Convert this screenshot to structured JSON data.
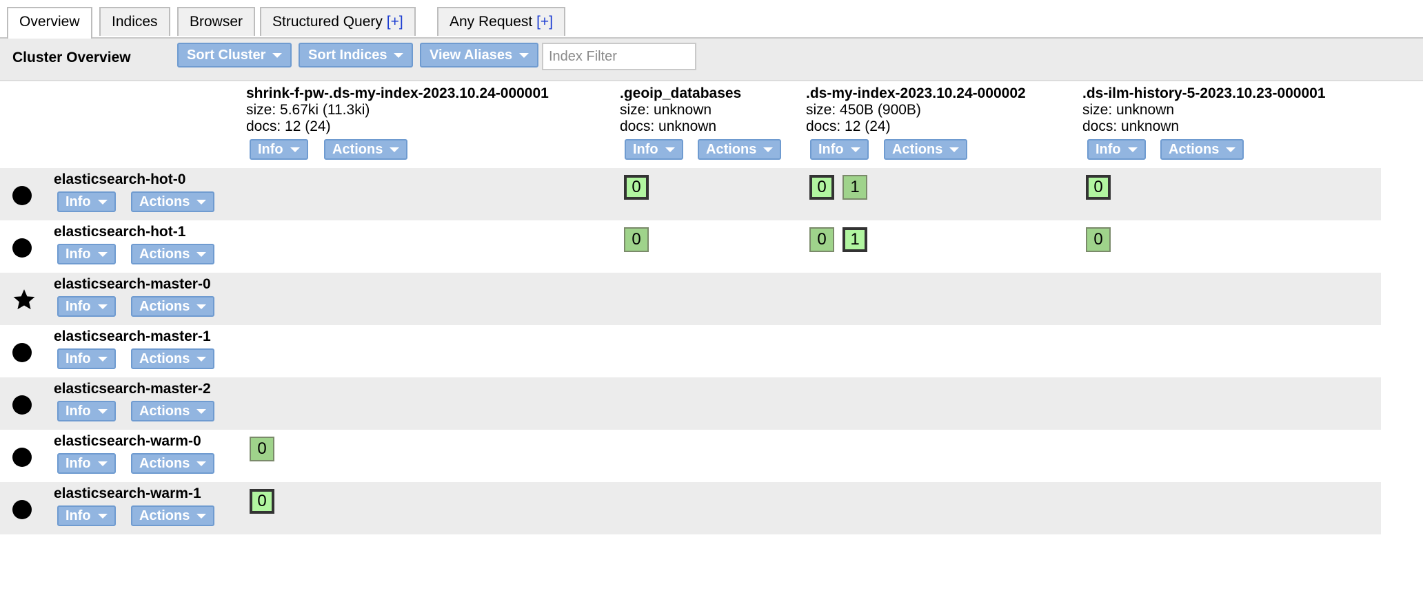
{
  "tabs": [
    {
      "label": "Overview",
      "plus": ""
    },
    {
      "label": "Indices",
      "plus": ""
    },
    {
      "label": "Browser",
      "plus": ""
    },
    {
      "label": "Structured Query",
      "plus": "[+]"
    },
    {
      "label": "Any Request",
      "plus": "[+]"
    }
  ],
  "toolbar": {
    "title": "Cluster Overview",
    "sort_cluster": "Sort Cluster",
    "sort_indices": "Sort Indices",
    "view_aliases": "View Aliases",
    "filter_placeholder": "Index Filter"
  },
  "buttons": {
    "info": "Info",
    "actions": "Actions"
  },
  "indices": [
    {
      "name": "shrink-f-pw-.ds-my-index-2023.10.24-000001",
      "size": "size: 5.67ki (11.3ki)",
      "docs": "docs: 12 (24)"
    },
    {
      "name": ".geoip_databases",
      "size": "size: unknown",
      "docs": "docs: unknown"
    },
    {
      "name": ".ds-my-index-2023.10.24-000002",
      "size": "size: 450B (900B)",
      "docs": "docs: 12 (24)"
    },
    {
      "name": ".ds-ilm-history-5-2023.10.23-000001",
      "size": "size: unknown",
      "docs": "docs: unknown"
    }
  ],
  "nodes": [
    {
      "name": "elasticsearch-hot-0",
      "icon": "dot-icon"
    },
    {
      "name": "elasticsearch-hot-1",
      "icon": "dot-icon"
    },
    {
      "name": "elasticsearch-master-0",
      "icon": "star-icon"
    },
    {
      "name": "elasticsearch-master-1",
      "icon": "dot-icon"
    },
    {
      "name": "elasticsearch-master-2",
      "icon": "dot-icon"
    },
    {
      "name": "elasticsearch-warm-0",
      "icon": "dot-icon"
    },
    {
      "name": "elasticsearch-warm-1",
      "icon": "dot-icon"
    }
  ],
  "shards": {
    "hot0_geoip": "0",
    "hot0_myindex_a": "0",
    "hot0_myindex_b": "1",
    "hot0_ilm": "0",
    "hot1_geoip": "0",
    "hot1_myindex_a": "0",
    "hot1_myindex_b": "1",
    "hot1_ilm": "0",
    "warm0_shrink": "0",
    "warm1_shrink": "0"
  },
  "colors": {
    "button": "#92b5e0",
    "shard": "#9fd38b",
    "row_shade": "#ececec"
  }
}
